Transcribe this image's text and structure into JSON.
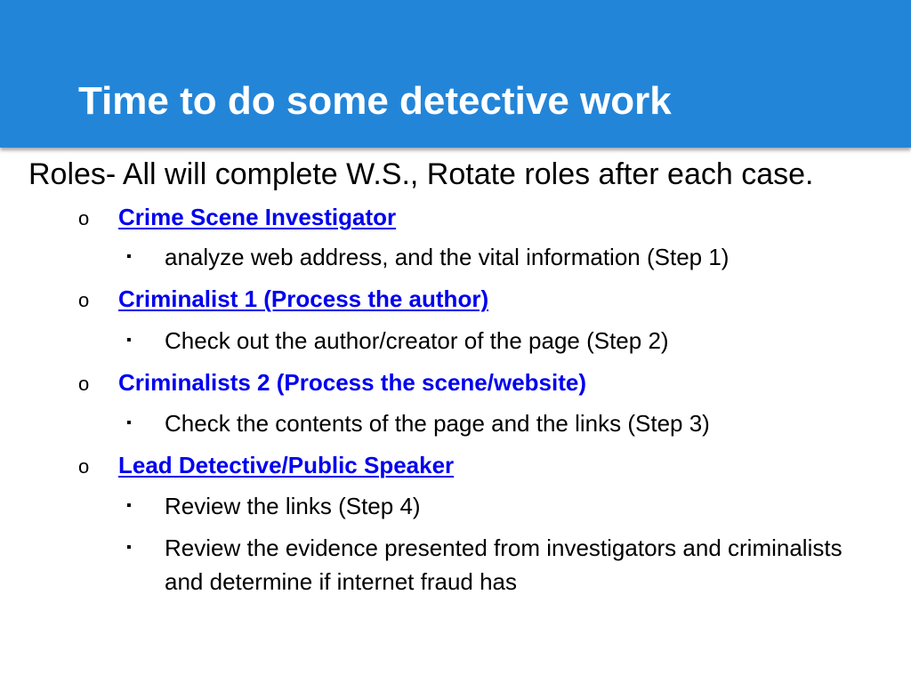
{
  "slide": {
    "title": "Time to do some detective work",
    "intro": "Roles- All will complete W.S., Rotate roles after each case.",
    "roles": [
      {
        "name": "Crime Scene Investigator",
        "link": true,
        "tasks": [
          "analyze web address, and the vital information (Step 1)"
        ]
      },
      {
        "name": "Criminalist 1 (Process the author)",
        "link": true,
        "tasks": [
          "Check out the author/creator of the page (Step 2)"
        ]
      },
      {
        "name": "Criminalists 2  (Process the scene/website)",
        "link": false,
        "tasks": [
          "Check the contents of the page and the links (Step 3)"
        ]
      },
      {
        "name": "Lead Detective/Public Speaker",
        "link": true,
        "tasks": [
          "Review the links (Step 4)",
          "Review the evidence presented from investigators and criminalists and determine if internet fraud has"
        ]
      }
    ],
    "bullets": {
      "level2": "o",
      "level3": "▪"
    },
    "colors": {
      "title_bar": "#2385d8",
      "title_text": "#ffffff",
      "link": "#0000ee"
    }
  }
}
